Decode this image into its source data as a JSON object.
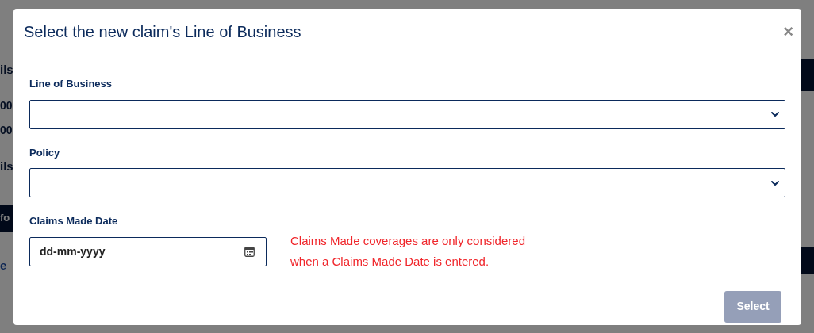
{
  "background": {
    "left_fragments": [
      {
        "kind": "heading",
        "text": "ils"
      },
      {
        "kind": "value",
        "text": "00"
      },
      {
        "kind": "value",
        "text": "00"
      },
      {
        "kind": "heading",
        "text": "ils"
      },
      {
        "kind": "bar",
        "text": "fo"
      },
      {
        "kind": "link",
        "text": "e"
      }
    ]
  },
  "dialog": {
    "title": "Select the new claim's Line of Business",
    "close": "×",
    "fields": [
      {
        "kind": "select",
        "label": "Line of Business"
      },
      {
        "kind": "select",
        "label": "Policy"
      }
    ],
    "date_field": {
      "label": "Claims Made Date",
      "placeholder": "dd-mm-yyyy"
    },
    "note": "Claims Made coverages are only considered when a Claims Made Date is entered.",
    "button": {
      "label": "Select",
      "disabled": true
    }
  }
}
